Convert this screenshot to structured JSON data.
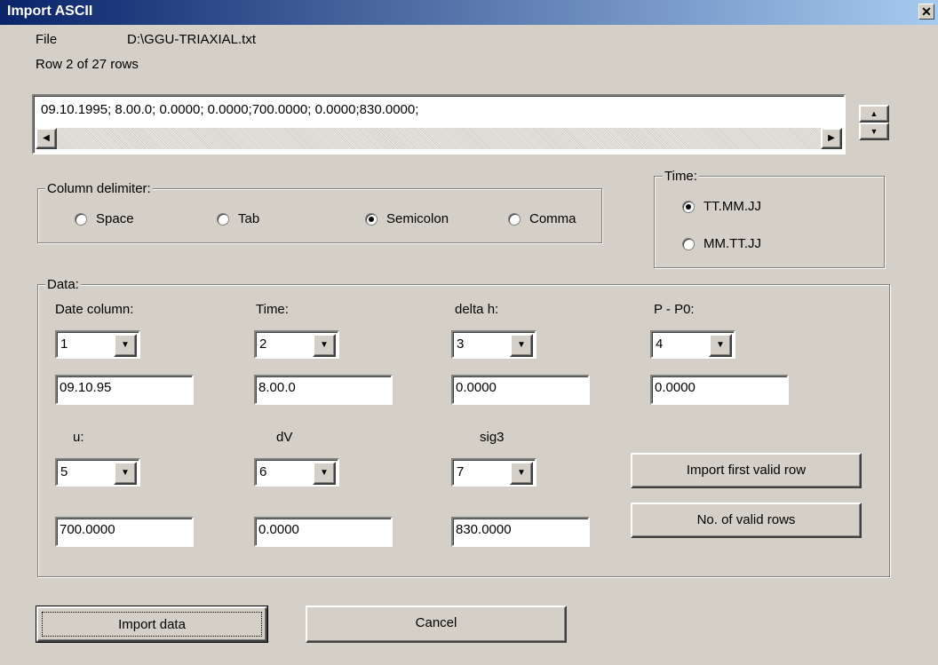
{
  "window": {
    "title": "Import ASCII",
    "close_glyph": "✕"
  },
  "file": {
    "label": "File",
    "path": "D:\\GGU-TRIAXIAL.txt"
  },
  "row_info": "Row 2 of  27 rows",
  "preview_line": "09.10.1995;  8.00.0;  0.0000;  0.0000;700.0000;  0.0000;830.0000;",
  "column_delimiter": {
    "title": "Column delimiter:",
    "options": [
      "Space",
      "Tab",
      "Semicolon",
      "Comma"
    ],
    "selected": "Semicolon"
  },
  "time_format": {
    "title": "Time:",
    "options": [
      "TT.MM.JJ",
      "MM.TT.JJ"
    ],
    "selected": "TT.MM.JJ"
  },
  "data_group": {
    "title": "Data:",
    "fields": [
      {
        "label": "Date column:",
        "column": "1",
        "value": "09.10.95"
      },
      {
        "label": "Time:",
        "column": "2",
        "value": "8.00.0"
      },
      {
        "label": "delta h:",
        "column": "3",
        "value": "0.0000"
      },
      {
        "label": "P - P0:",
        "column": "4",
        "value": "0.0000"
      },
      {
        "label": "u:",
        "column": "5",
        "value": "700.0000"
      },
      {
        "label": "dV",
        "column": "6",
        "value": "0.0000"
      },
      {
        "label": "sig3",
        "column": "7",
        "value": "830.0000"
      }
    ]
  },
  "buttons": {
    "import_first_valid_row": "Import first valid row",
    "no_of_valid_rows": "No. of valid rows",
    "import_data": "Import data",
    "cancel": "Cancel"
  }
}
